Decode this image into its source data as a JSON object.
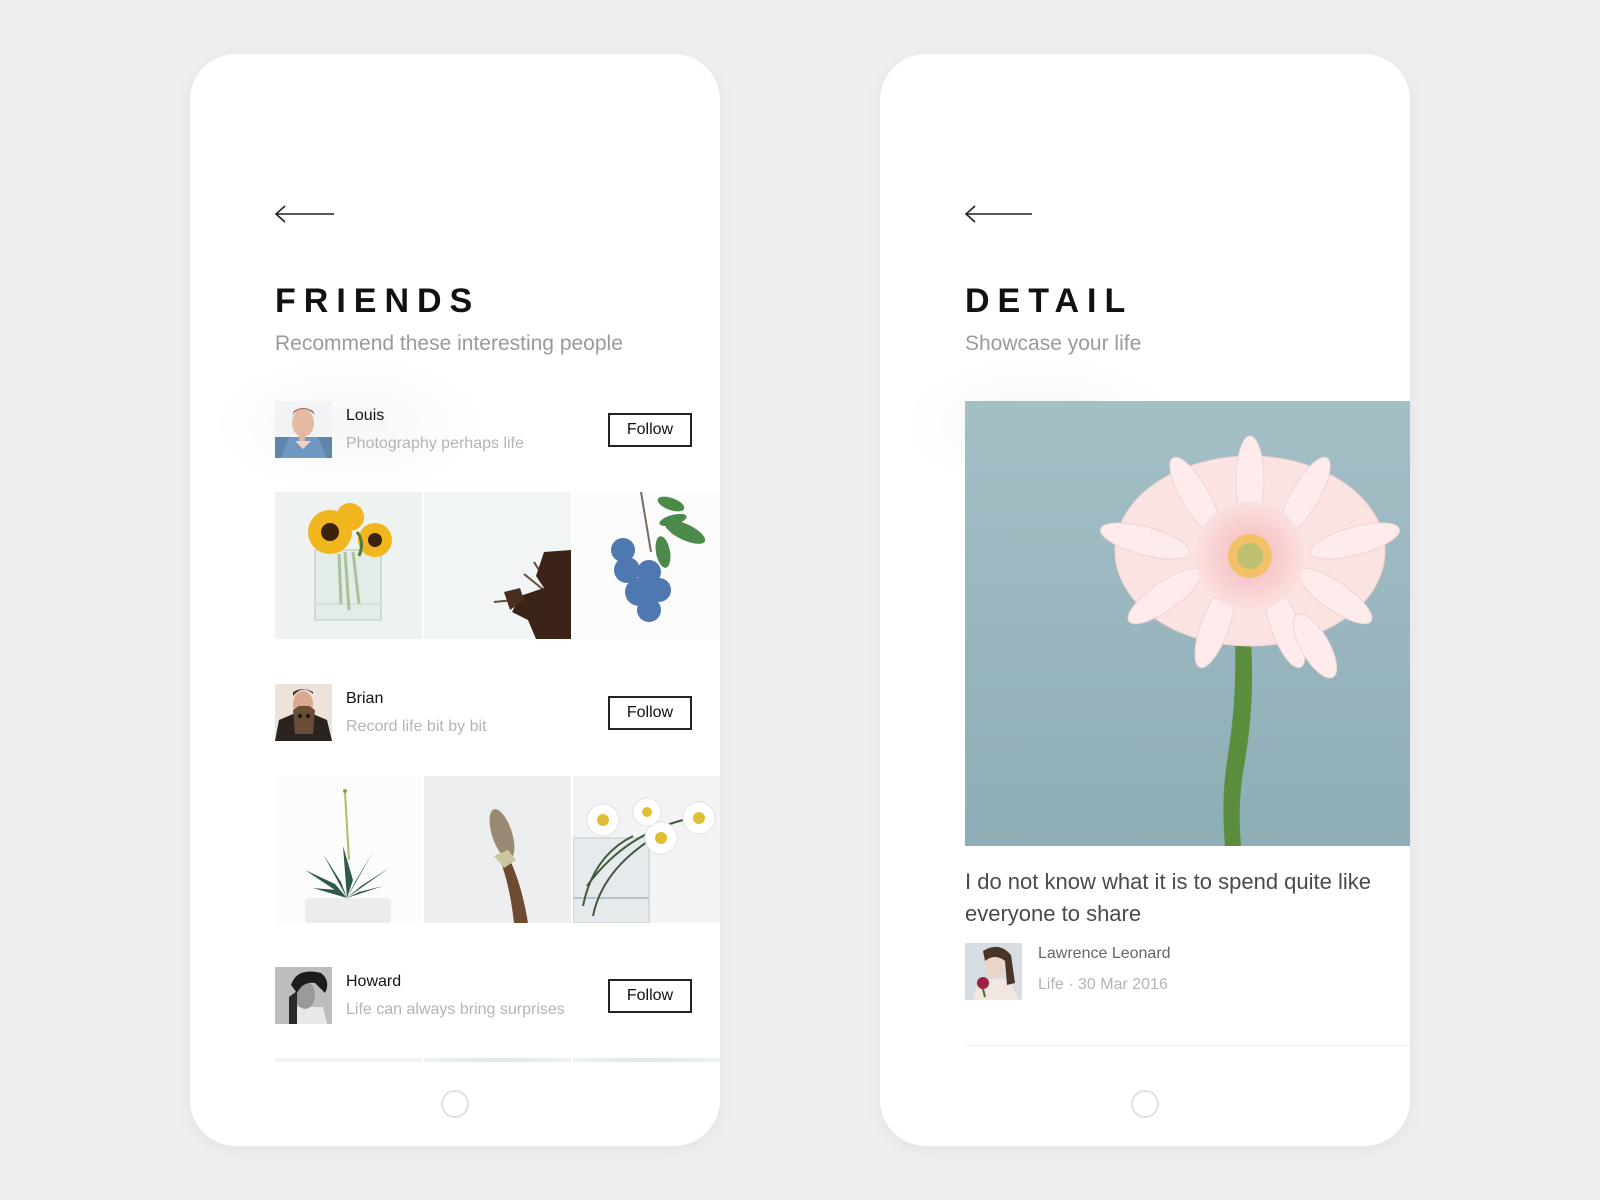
{
  "friends_screen": {
    "back_icon": "arrow-left-icon",
    "title": "FRIENDS",
    "subtitle": "Recommend these interesting people",
    "people": [
      {
        "name": "Louis",
        "bio": "Photography perhaps life",
        "follow_label": "Follow",
        "photos": [
          "sunflowers in glass vase",
          "dried oak leaves branch",
          "blueberries on branch"
        ]
      },
      {
        "name": "Brian",
        "bio": "Record life bit by bit",
        "follow_label": "Follow",
        "photos": [
          "succulent in white pot",
          "flower bud on twig",
          "daisies in glass jar"
        ]
      },
      {
        "name": "Howard",
        "bio": "Life can always bring surprises",
        "follow_label": "Follow",
        "photos": [
          "photo",
          "photo",
          "photo"
        ]
      }
    ],
    "home_icon": "home-indicator-icon"
  },
  "detail_screen": {
    "back_icon": "arrow-left-icon",
    "title": "DETAIL",
    "subtitle": "Showcase your life",
    "hero_image": "pink gerbera flower on blue background",
    "post_text": "I do not know what it is to spend quite like everyone to share",
    "author": {
      "name": "Lawrence Leonard",
      "category": "Life",
      "separator": "·",
      "date": "30 Mar 2016",
      "meta": "Life · 30 Mar 2016"
    },
    "home_icon": "home-indicator-icon"
  },
  "colors": {
    "background": "#efefef",
    "card": "#ffffff",
    "title": "#111111",
    "subtitle": "#9a9a9a",
    "muted": "#b4b4b4",
    "hero_bg": "#9fbcc3"
  }
}
